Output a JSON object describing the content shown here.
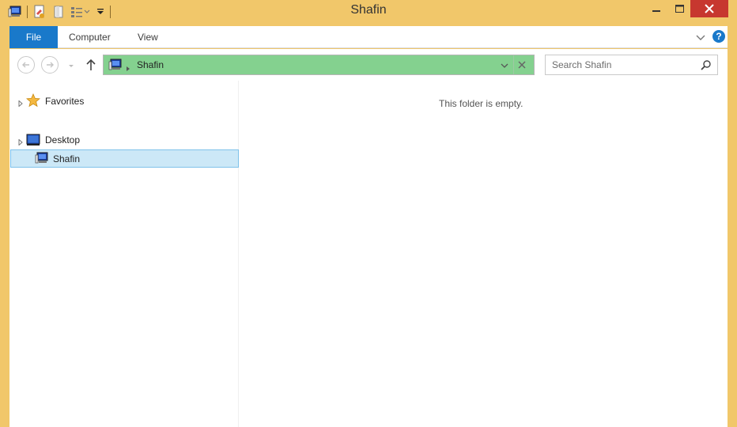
{
  "window": {
    "title": "Shafin"
  },
  "ribbon": {
    "tabs": {
      "file": "File",
      "computer": "Computer",
      "view": "View"
    },
    "help_icon": "?"
  },
  "address_bar": {
    "location": "Shafin"
  },
  "search": {
    "placeholder": "Search Shafin"
  },
  "nav_pane": {
    "favorites": "Favorites",
    "desktop": "Desktop",
    "selected": "Shafin"
  },
  "main": {
    "empty_message": "This folder is empty."
  },
  "colors": {
    "title_bar": "#f1c76a",
    "file_tab": "#1979ca",
    "address_highlight": "#84d18f",
    "close_button": "#c7372f",
    "selection": "#cce8f7"
  }
}
